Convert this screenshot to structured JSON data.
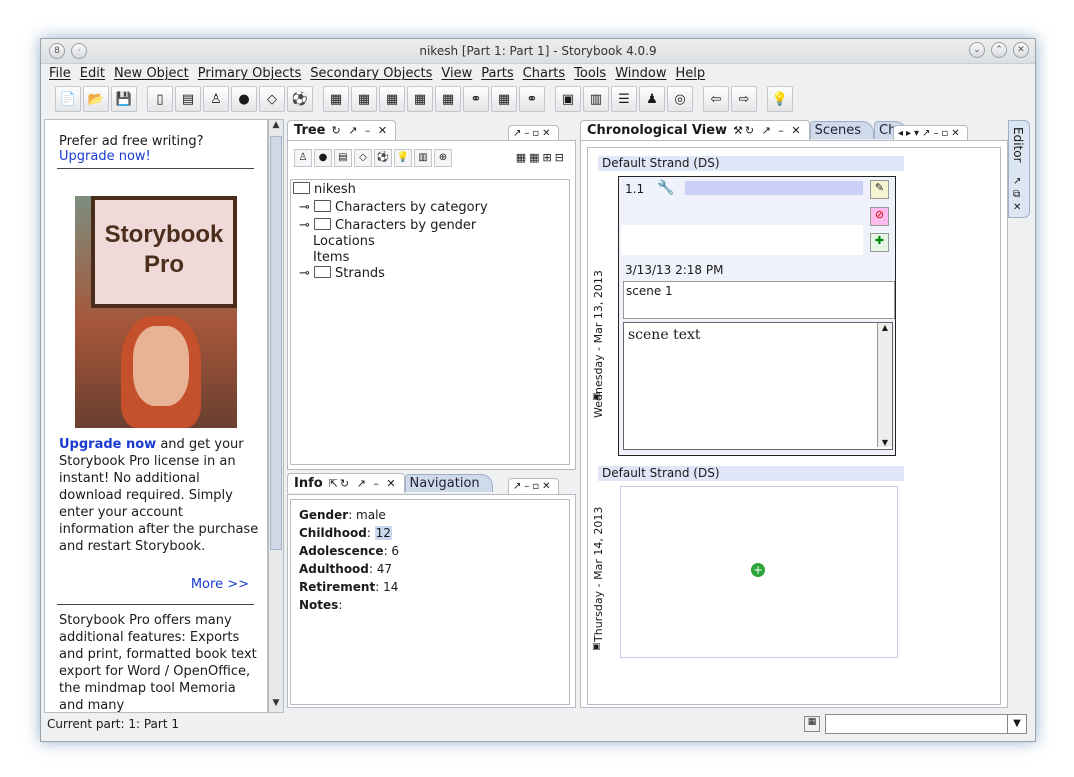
{
  "window": {
    "title": "nikesh [Part 1: Part 1] - Storybook 4.0.9",
    "menu": [
      "File",
      "Edit",
      "New Object",
      "Primary Objects",
      "Secondary Objects",
      "View",
      "Parts",
      "Charts",
      "Tools",
      "Window",
      "Help"
    ]
  },
  "promo": {
    "line1": "Prefer ad free writing?",
    "upgrade_link": "Upgrade now!",
    "sign_line1": "Storybook",
    "sign_line2": "Pro",
    "upgrade_bold": "Upgrade now",
    "body": " and get your Storybook Pro license in an instant! No additional download required. Simply enter your account information after the purchase and restart Storybook.",
    "more": "More >>",
    "pro_features": "Storybook Pro offers many additional features: Exports and print, formatted book text export for Word / OpenOffice, the mindmap tool Memoria and many"
  },
  "tree": {
    "tab_label": "Tree",
    "root": "nikesh",
    "nodes": [
      "Characters by category",
      "Characters by gender",
      "Locations",
      "Items",
      "Strands"
    ]
  },
  "info": {
    "tab_label": "Info",
    "nav_tab": "Navigation",
    "fields": [
      {
        "label": "Gender",
        "value": "male"
      },
      {
        "label": "Childhood",
        "value": "12"
      },
      {
        "label": "Adolescence",
        "value": "6"
      },
      {
        "label": "Adulthood",
        "value": "47"
      },
      {
        "label": "Retirement",
        "value": "14"
      },
      {
        "label": "Notes",
        "value": ""
      }
    ]
  },
  "chrono": {
    "tab_label": "Chronological View",
    "tab_scenes": "Scenes",
    "tab_cha": "Cha",
    "strand1": "Default Strand (DS)",
    "strand2": "Default Strand (DS)",
    "date1": "Wednesday - Mar 13, 2013",
    "date2": "Thursday - Mar 14, 2013",
    "scene_number": "1.1",
    "scene_datetime": "3/13/13 2:18 PM",
    "scene_title": "scene 1",
    "scene_text": "scene text"
  },
  "editor": {
    "label": "Editor"
  },
  "status": {
    "current_part": "Current part: 1: Part 1"
  }
}
